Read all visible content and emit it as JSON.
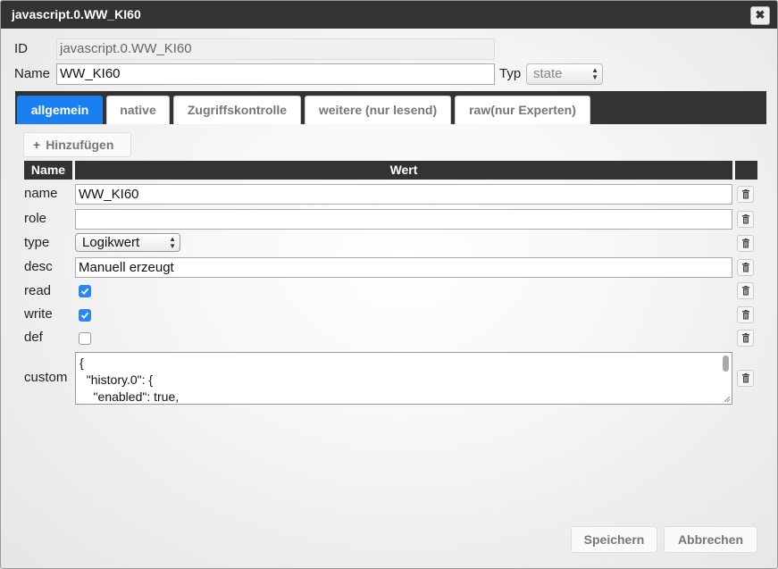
{
  "dialog": {
    "title": "javascript.0.WW_KI60",
    "close_icon": "close-icon"
  },
  "header": {
    "id_label": "ID",
    "id_value": "javascript.0.WW_KI60",
    "name_label": "Name",
    "name_value": "WW_KI60",
    "typ_label": "Typ",
    "typ_value": "state"
  },
  "tabs": [
    {
      "label": "allgemein",
      "active": true
    },
    {
      "label": "native"
    },
    {
      "label": "Zugriffskontrolle"
    },
    {
      "label": "weitere (nur lesend)"
    },
    {
      "label": "raw(nur Experten)"
    }
  ],
  "add_button": {
    "icon": "+",
    "label": "Hinzufügen"
  },
  "table": {
    "headers": {
      "name": "Name",
      "value": "Wert"
    },
    "rows": [
      {
        "name": "name",
        "value": "WW_KI60"
      },
      {
        "name": "role",
        "value": ""
      },
      {
        "name": "type",
        "value": "Logikwert"
      },
      {
        "name": "desc",
        "value": "Manuell erzeugt"
      },
      {
        "name": "read",
        "checked": true
      },
      {
        "name": "write",
        "checked": true
      },
      {
        "name": "def",
        "checked": false
      },
      {
        "name": "custom",
        "lines": [
          "{",
          "  \"history.0\": {",
          "    \"enabled\": true,"
        ]
      }
    ]
  },
  "footer": {
    "save_label": "Speichern",
    "cancel_label": "Abbrechen"
  },
  "colors": {
    "accent": "#1a7ff0",
    "header_bg": "#333333",
    "checkbox": "#2d86f0"
  }
}
